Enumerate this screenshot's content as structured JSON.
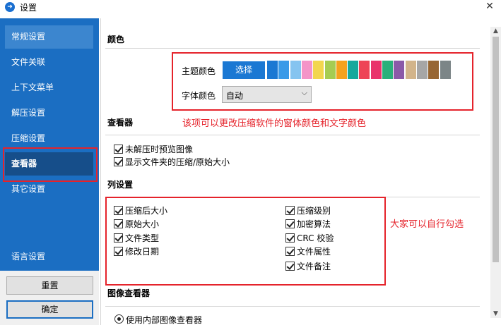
{
  "window": {
    "title": "设置",
    "close_glyph": "✕"
  },
  "sidebar": {
    "items": [
      {
        "label": "常规设置"
      },
      {
        "label": "文件关联"
      },
      {
        "label": "上下文菜单"
      },
      {
        "label": "解压设置"
      },
      {
        "label": "压缩设置"
      },
      {
        "label": "查看器",
        "active": true
      },
      {
        "label": "其它设置"
      },
      {
        "label": "语言设置"
      }
    ],
    "reset_label": "重置",
    "ok_label": "确定"
  },
  "color_section": {
    "title": "颜色",
    "theme_label": "主题颜色",
    "select_button": "选择",
    "swatches": [
      "#1b78d3",
      "#3a9ae8",
      "#85c4f0",
      "#f494c8",
      "#f2d64f",
      "#a6cc52",
      "#f5a21d",
      "#17a89c",
      "#ee4456",
      "#e9336b",
      "#2ab07a",
      "#8b5aa8",
      "#d2b48a",
      "#a6a6a6",
      "#976633",
      "#7c8587"
    ],
    "font_color_label": "字体颜色",
    "font_color_value": "自动",
    "annotation": "该项可以更改压缩软件的窗体颜色和文字颜色"
  },
  "viewer_section": {
    "title": "查看器",
    "options": [
      {
        "label": "未解压时预览图像",
        "checked": true
      },
      {
        "label": "显示文件夹的压缩/原始大小",
        "checked": true
      }
    ]
  },
  "columns_section": {
    "title": "列设置",
    "left_column": [
      {
        "label": "压缩后大小",
        "checked": true
      },
      {
        "label": "原始大小",
        "checked": true
      },
      {
        "label": "文件类型",
        "checked": true
      },
      {
        "label": "修改日期",
        "checked": true
      }
    ],
    "right_column": [
      {
        "label": "压缩级别",
        "checked": true
      },
      {
        "label": "加密算法",
        "checked": true
      },
      {
        "label": "CRC 校验",
        "checked": true
      },
      {
        "label": "文件属性",
        "checked": true
      },
      {
        "label": "文件备注",
        "checked": true
      }
    ],
    "annotation": "大家可以自行勾选"
  },
  "image_viewer_section": {
    "title": "图像查看器",
    "option_label": "使用内部图像查看器"
  },
  "colors": {
    "accent": "#1b6ec2",
    "highlight": "#e5232b"
  }
}
